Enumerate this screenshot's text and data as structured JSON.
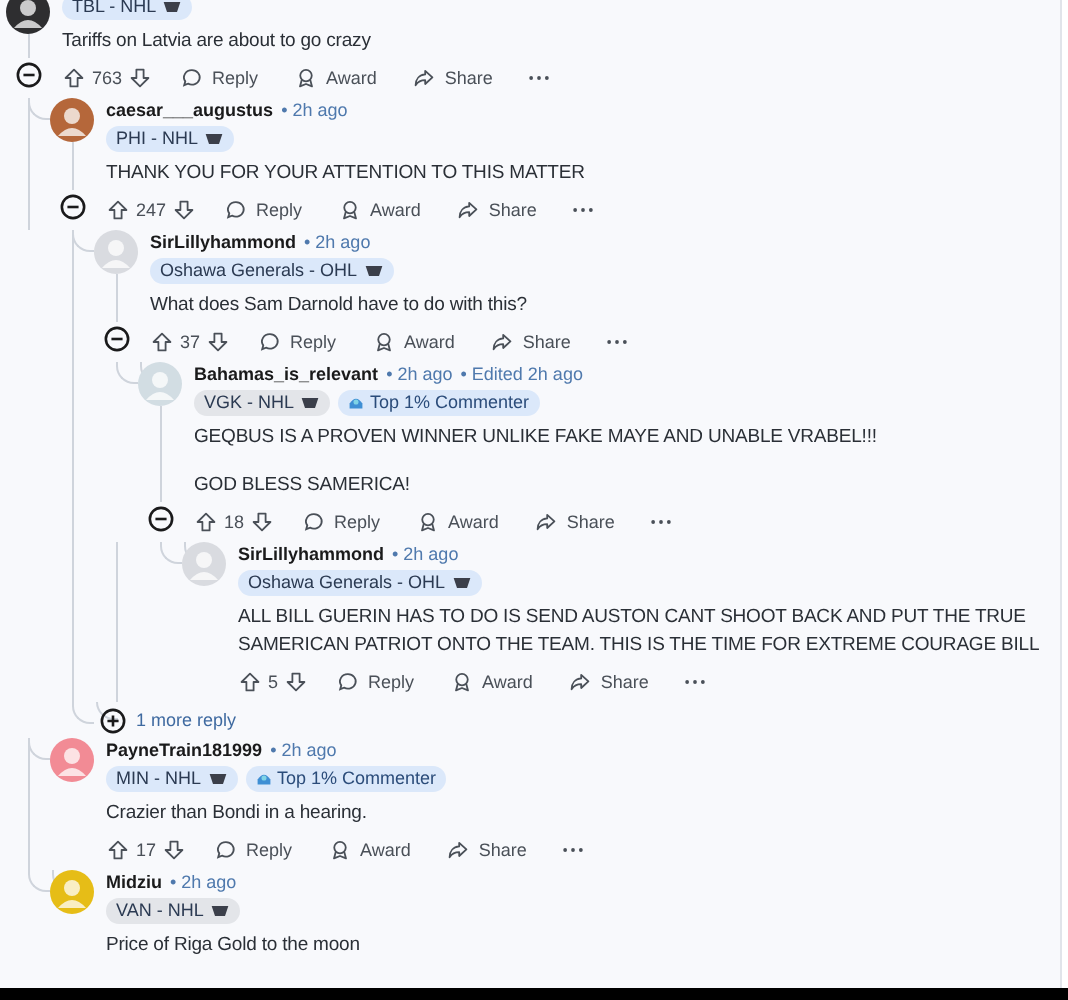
{
  "comments": [
    {
      "kind": "comment",
      "avatar": {
        "color": "#2e2e30"
      },
      "flair": {
        "text": "TBL - NHL",
        "color": "#dbe8fa"
      },
      "body": [
        "Tariffs on Latvia are about to go crazy"
      ],
      "votes": "763",
      "expanded": true,
      "actions": [
        {
          "kind": "reply",
          "label": "Reply"
        },
        {
          "kind": "award",
          "label": "Award"
        },
        {
          "kind": "share",
          "label": "Share"
        }
      ],
      "children": [
        {
          "kind": "comment",
          "author": "caesar___augustus",
          "time": "• 2h ago",
          "avatar": {
            "color": "#b5673a"
          },
          "flair": {
            "text": "PHI - NHL",
            "color": "#dbe8fa"
          },
          "body": [
            "THANK YOU FOR YOUR ATTENTION TO THIS MATTER"
          ],
          "votes": "247",
          "expanded": true,
          "actions": [
            {
              "kind": "reply",
              "label": "Reply"
            },
            {
              "kind": "award",
              "label": "Award"
            },
            {
              "kind": "share",
              "label": "Share"
            }
          ],
          "children": [
            {
              "kind": "comment",
              "author": "SirLillyhammond",
              "time": "• 2h ago",
              "avatar": {
                "color": "#d9dbe0"
              },
              "flair": {
                "text": "Oshawa Generals - OHL",
                "color": "#dbe8fa"
              },
              "body": [
                "What does Sam Darnold have to do with this?"
              ],
              "votes": "37",
              "expanded": true,
              "actions": [
                {
                  "kind": "reply",
                  "label": "Reply"
                },
                {
                  "kind": "award",
                  "label": "Award"
                },
                {
                  "kind": "share",
                  "label": "Share"
                }
              ],
              "children": [
                {
                  "kind": "comment",
                  "author": "Bahamas_is_relevant",
                  "time": "• 2h ago",
                  "edited": "• Edited 2h ago",
                  "avatar": {
                    "color": "#d2dde3"
                  },
                  "flair": {
                    "text": "VGK - NHL",
                    "color": "#e3e5e9"
                  },
                  "badges": [
                    "Top 1% Commenter"
                  ],
                  "body": [
                    "GEQBUS IS A PROVEN WINNER UNLIKE FAKE MAYE AND UNABLE VRABEL!!!",
                    "GOD BLESS SAMERICA!"
                  ],
                  "votes": "18",
                  "expanded": true,
                  "actions": [
                    {
                      "kind": "reply",
                      "label": "Reply"
                    },
                    {
                      "kind": "award",
                      "label": "Award"
                    },
                    {
                      "kind": "share",
                      "label": "Share"
                    }
                  ],
                  "children": [
                    {
                      "kind": "comment",
                      "author": "SirLillyhammond",
                      "time": "• 2h ago",
                      "avatar": {
                        "color": "#d9dbe0"
                      },
                      "flair": {
                        "text": "Oshawa Generals - OHL",
                        "color": "#dbe8fa"
                      },
                      "body": [
                        "ALL BILL GUERIN HAS TO DO IS SEND AUSTON CANT SHOOT BACK AND PUT THE TRUE SAMERICAN PATRIOT ONTO THE TEAM. THIS IS THE TIME FOR EXTREME COURAGE BILL"
                      ],
                      "votes": "5",
                      "actions": [
                        {
                          "kind": "reply",
                          "label": "Reply"
                        },
                        {
                          "kind": "award",
                          "label": "Award"
                        },
                        {
                          "kind": "share",
                          "label": "Share"
                        }
                      ]
                    }
                  ]
                }
              ]
            },
            {
              "kind": "more",
              "label": "1 more reply"
            }
          ]
        },
        {
          "kind": "comment",
          "author": "PayneTrain181999",
          "time": "• 2h ago",
          "avatar": {
            "color": "#f28b95"
          },
          "flair": {
            "text": "MIN - NHL",
            "color": "#dbe8fa"
          },
          "badges": [
            "Top 1% Commenter"
          ],
          "body": [
            "Crazier than Bondi in a hearing."
          ],
          "votes": "17",
          "actions": [
            {
              "kind": "reply",
              "label": "Reply"
            },
            {
              "kind": "award",
              "label": "Award"
            },
            {
              "kind": "share",
              "label": "Share"
            }
          ]
        },
        {
          "kind": "comment",
          "author": "Midziu",
          "time": "• 2h ago",
          "avatar": {
            "color": "#e6bd17"
          },
          "flair": {
            "text": "VAN - NHL",
            "color": "#e3e5e9"
          },
          "body": [
            "Price of Riga Gold to the moon"
          ]
        }
      ]
    }
  ]
}
